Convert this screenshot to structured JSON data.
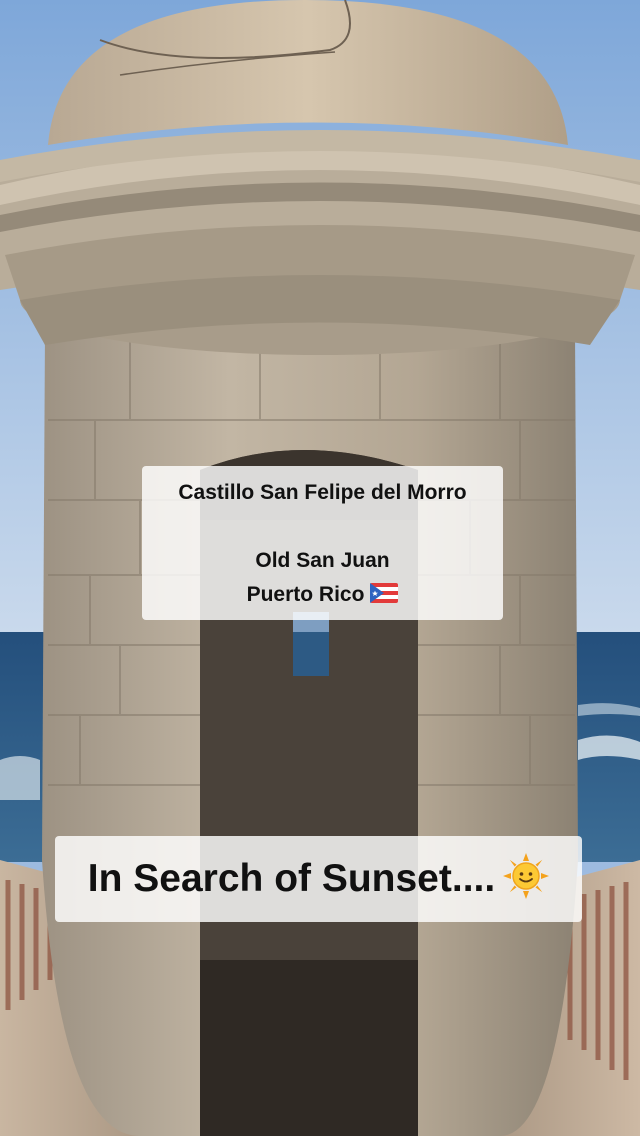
{
  "overlay": {
    "location_title": "Castillo San Felipe del Morro",
    "location_line1": "Old San Juan",
    "location_line2": "Puerto Rico",
    "flag_icon": "puerto-rico-flag-icon",
    "headline": "In Search of Sunset....",
    "headline_icon": "sun-emoji-icon"
  },
  "colors": {
    "sky": "#9dbbe0",
    "ocean": "#2e5f88",
    "stone": "#b5a896",
    "stone_dark": "#7d7264",
    "brick": "#a36b55"
  }
}
